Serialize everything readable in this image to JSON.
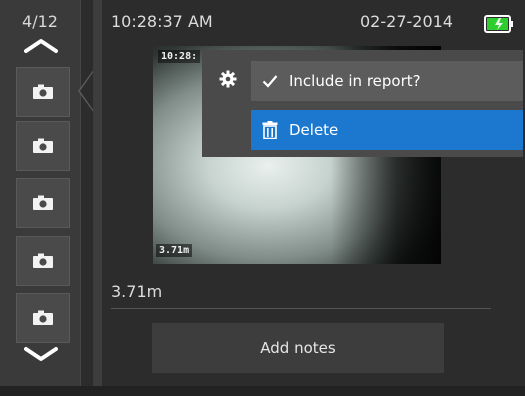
{
  "sidebar": {
    "counter": "4/12",
    "thumbnails": [
      {
        "icon": "camera-icon"
      },
      {
        "icon": "camera-icon"
      },
      {
        "icon": "camera-icon"
      },
      {
        "icon": "camera-icon"
      },
      {
        "icon": "camera-icon"
      }
    ],
    "selected_index": 0
  },
  "header": {
    "time": "10:28:37 AM",
    "date": "02-27-2014",
    "battery_icon": "battery-charging-icon",
    "battery_color": "#2ecc2e"
  },
  "photo": {
    "overlay_time": "10:28:",
    "overlay_distance": "3.71m"
  },
  "context_menu": {
    "settings_icon": "gear-icon",
    "items": [
      {
        "label": "Include in report?",
        "icon": "checkmark-icon"
      },
      {
        "label": "Delete",
        "icon": "trash-icon"
      }
    ],
    "highlight_color": "#1c78cf"
  },
  "distance": "3.71m",
  "add_notes_label": "Add notes"
}
